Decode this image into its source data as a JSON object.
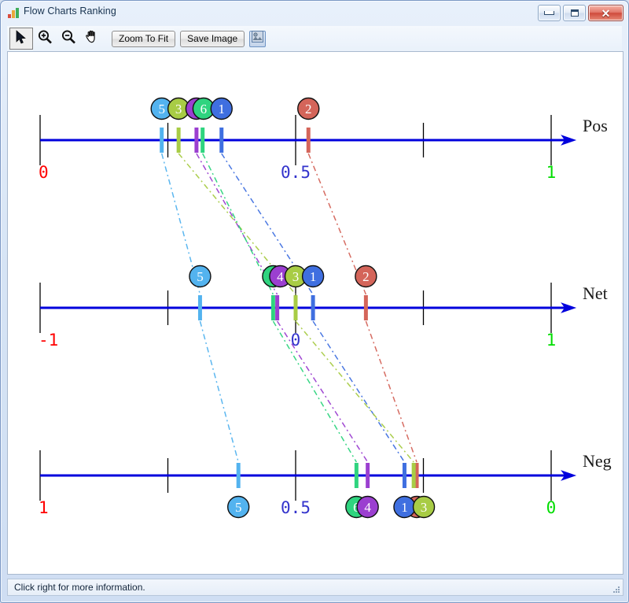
{
  "window": {
    "title": "Flow Charts Ranking",
    "icon": "bar-chart-icon",
    "buttons": {
      "minimize": "minimize-icon",
      "maximize": "maximize-icon",
      "close": "✕"
    }
  },
  "toolbar": {
    "tools": [
      {
        "name": "pointer-tool",
        "icon": "arrow-cursor-icon",
        "selected": true
      },
      {
        "name": "zoom-in-tool",
        "icon": "magnifier-plus-icon",
        "selected": false
      },
      {
        "name": "zoom-out-tool",
        "icon": "magnifier-minus-icon",
        "selected": false
      },
      {
        "name": "pan-tool",
        "icon": "hand-icon",
        "selected": false
      }
    ],
    "zoom_to_fit_label": "Zoom To Fit",
    "save_image_label": "Save Image",
    "image_options_icon": "image-icon"
  },
  "statusbar": {
    "message": "Click right for more information."
  },
  "colors": {
    "axis": "#0000dd",
    "tick": "#000000",
    "label_min": "#ff0000",
    "label_mid": "#3333cc",
    "label_max": "#00dd00",
    "background": "#ffffff",
    "alt_1": "#3f6fe0",
    "alt_2": "#d4655a",
    "alt_3": "#a8cc45",
    "alt_4": "#9b3fd0",
    "alt_5": "#53b3ef",
    "alt_6": "#2fd47f"
  },
  "chart_data": {
    "type": "scatter",
    "title": "Flow Charts Ranking",
    "description": "PROMETHEE flow chart: three parallel numeric axes showing Positive, Net and Negative flow scores for six alternatives, connected by dash-dot lines.",
    "alternatives": [
      {
        "id": "1",
        "color": "#3f6fe0"
      },
      {
        "id": "2",
        "color": "#d4655a"
      },
      {
        "id": "3",
        "color": "#a8cc45"
      },
      {
        "id": "4",
        "color": "#9b3fd0"
      },
      {
        "id": "5",
        "color": "#53b3ef"
      },
      {
        "id": "6",
        "color": "#2fd47f"
      }
    ],
    "axes": [
      {
        "name": "Pos",
        "label": "Pos",
        "min": 0,
        "max": 1,
        "tick_labels": [
          "0",
          "0.5",
          "1"
        ],
        "tick_values": [
          0,
          0.5,
          1
        ],
        "minor_ticks": [
          0.25,
          0.75
        ],
        "values": {
          "1": 0.355,
          "2": 0.525,
          "3": 0.271,
          "4": 0.306,
          "5": 0.238,
          "6": 0.318
        }
      },
      {
        "name": "Net",
        "label": "Net",
        "min": -1,
        "max": 1,
        "tick_labels": [
          "-1",
          "0",
          "1"
        ],
        "tick_values": [
          -1,
          0,
          1
        ],
        "minor_ticks": [
          -0.5,
          0.5
        ],
        "values": {
          "1": 0.068,
          "2": 0.275,
          "3": 0.0,
          "4": -0.072,
          "5": -0.374,
          "6": -0.088
        }
      },
      {
        "name": "Neg",
        "label": "Neg",
        "min": 1,
        "max": 0,
        "tick_labels": [
          "1",
          "0.5",
          "0"
        ],
        "tick_values": [
          1,
          0.5,
          0
        ],
        "minor_ticks": [
          0.75,
          0.25
        ],
        "values": {
          "1": 0.287,
          "2": 0.263,
          "3": 0.269,
          "4": 0.359,
          "5": 0.612,
          "6": 0.381
        }
      }
    ],
    "xlabel": "",
    "ylabel": "",
    "grid": false,
    "legend": "none"
  }
}
